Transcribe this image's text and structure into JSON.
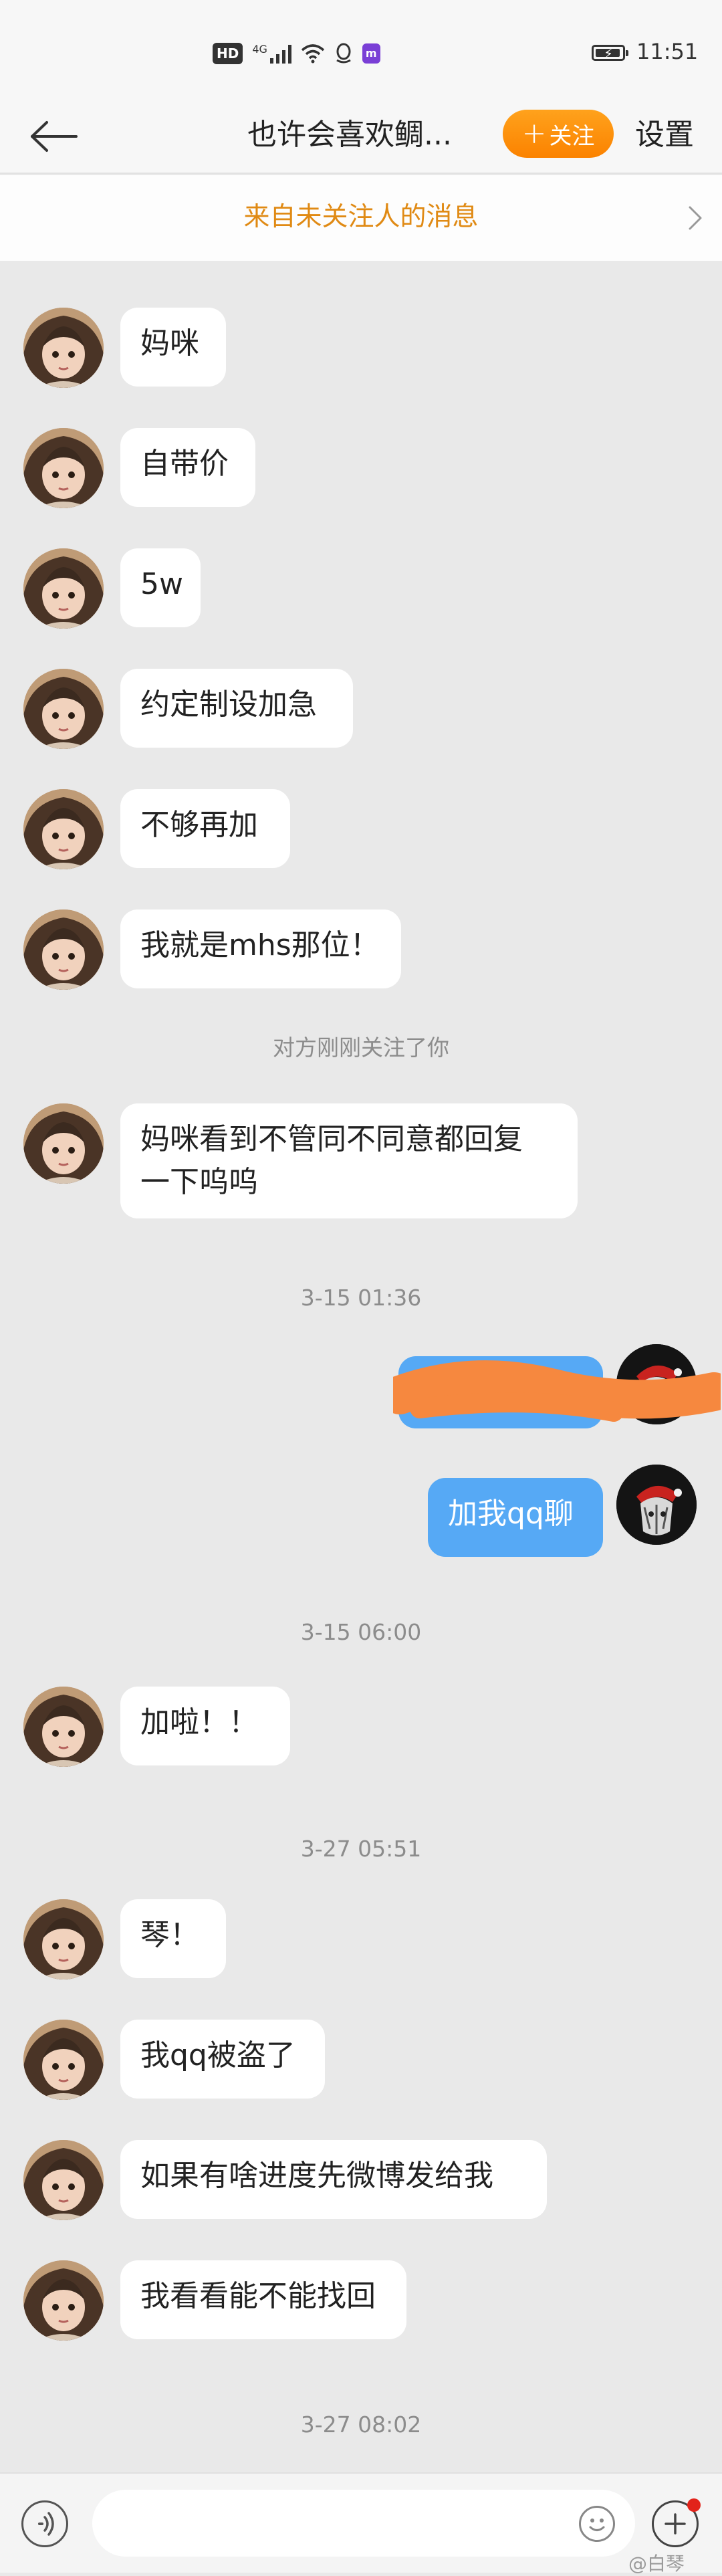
{
  "status_bar": {
    "hd_badge": "HD",
    "network": "4G",
    "app_badge": "m",
    "time": "11:51",
    "battery_level": 0.95
  },
  "header": {
    "title": "也许会喜欢鲷...",
    "follow_label": "关注",
    "follow_plus": "+",
    "settings_label": "设置",
    "follow_button_color": "#fb8200"
  },
  "notice": {
    "text": "来自未关注人的消息",
    "text_color": "#e08a14"
  },
  "chat": {
    "bubble_left_color": "#ffffff",
    "bubble_right_color": "#56a9f5",
    "messages": [
      {
        "side": "left",
        "text": "妈咪"
      },
      {
        "side": "left",
        "text": "自带价"
      },
      {
        "side": "left",
        "text": "5w"
      },
      {
        "side": "left",
        "text": "约定制设加急"
      },
      {
        "side": "left",
        "text": "不够再加"
      },
      {
        "side": "left",
        "text": "我就是mhs那位！"
      },
      {
        "side": "system",
        "text": "对方刚刚关注了你"
      },
      {
        "side": "left",
        "text": "妈咪看到不管同不同意都回复\n一下呜呜"
      },
      {
        "side": "time",
        "text": "3-15 01:36"
      },
      {
        "side": "right",
        "text": ""
      },
      {
        "side": "right",
        "text": "加我qq聊"
      },
      {
        "side": "time",
        "text": "3-15 06:00"
      },
      {
        "side": "left",
        "text": "加啦！！"
      },
      {
        "side": "time",
        "text": "3-27 05:51"
      },
      {
        "side": "left",
        "text": "琴！"
      },
      {
        "side": "left",
        "text": "我qq被盗了"
      },
      {
        "side": "left",
        "text": "如果有啥进度先微博发给我"
      },
      {
        "side": "left",
        "text": "我看看能不能找回"
      },
      {
        "side": "time",
        "text": "3-27 08:02"
      }
    ]
  },
  "input_bar": {
    "placeholder": "",
    "voice_icon": "voice-icon",
    "emoji_icon": "emoji-icon",
    "plus_icon": "plus-icon"
  },
  "watermark": "@白琴"
}
